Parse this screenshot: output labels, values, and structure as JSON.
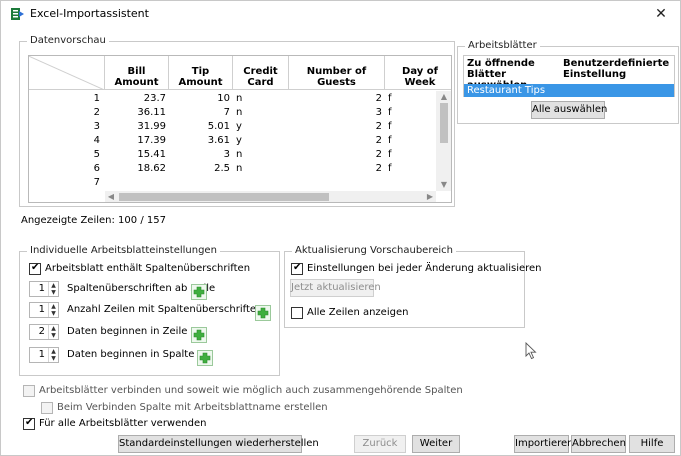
{
  "window": {
    "title": "Excel-Importassistent",
    "close": "✕"
  },
  "preview": {
    "legend": "Datenvorschau",
    "columns": [
      "Bill Amount",
      "Tip Amount",
      "Credit Card",
      "Number of Guests",
      "Day of Week"
    ],
    "rows": [
      {
        "n": "1",
        "cells": [
          "23.7",
          "10",
          "n",
          "2",
          "f"
        ]
      },
      {
        "n": "2",
        "cells": [
          "36.11",
          "7",
          "n",
          "3",
          "f"
        ]
      },
      {
        "n": "3",
        "cells": [
          "31.99",
          "5.01",
          "y",
          "2",
          "f"
        ]
      },
      {
        "n": "4",
        "cells": [
          "17.39",
          "3.61",
          "y",
          "2",
          "f"
        ]
      },
      {
        "n": "5",
        "cells": [
          "15.41",
          "3",
          "n",
          "2",
          "f"
        ]
      },
      {
        "n": "6",
        "cells": [
          "18.62",
          "2.5",
          "n",
          "2",
          "f"
        ]
      },
      {
        "n": "7",
        "cells": [
          "",
          "",
          "",
          "",
          ""
        ]
      }
    ],
    "shown_rows": "Angezeigte Zeilen: 100 / 157"
  },
  "sheets": {
    "legend": "Arbeitsblätter",
    "col1": "Zu öffnende Blätter auswählen",
    "col2": "Benutzerdefinierte Einstellung",
    "items": [
      "Restaurant Tips"
    ],
    "select_all": "Alle auswählen"
  },
  "individual": {
    "legend": "Individuelle Arbeitsblatteinstellungen",
    "has_headers": "Arbeitsblatt enthält Spaltenüberschriften",
    "header_row_value": "1",
    "header_row_label": "Spaltenüberschriften ab Zeile",
    "header_count_value": "1",
    "header_count_label": "Anzahl Zeilen mit Spaltenüberschriften",
    "data_row_value": "2",
    "data_row_label": "Daten beginnen in Zeile",
    "data_col_value": "1",
    "data_col_label": "Daten beginnen in Spalte"
  },
  "refresh": {
    "legend": "Aktualisierung Vorschaubereich",
    "auto_update": "Einstellungen bei jeder Änderung aktualisieren",
    "update_now": "Jetzt aktualisieren",
    "show_all_rows": "Alle Zeilen anzeigen"
  },
  "options": {
    "merge_sheets": "Arbeitsblätter verbinden und soweit wie möglich auch zusammengehörende Spalten",
    "merge_column": "Beim Verbinden Spalte mit Arbeitsblattname erstellen",
    "use_for_all": "Für alle Arbeitsblätter verwenden"
  },
  "buttons": {
    "restore": "Standardeinstellungen wiederherstellen",
    "back": "Zurück",
    "next": "Weiter",
    "import": "Importieren",
    "cancel": "Abbrechen",
    "help": "Hilfe"
  },
  "colors": {
    "selection": "#3a96e6",
    "plus_green": "#3fae3f"
  }
}
